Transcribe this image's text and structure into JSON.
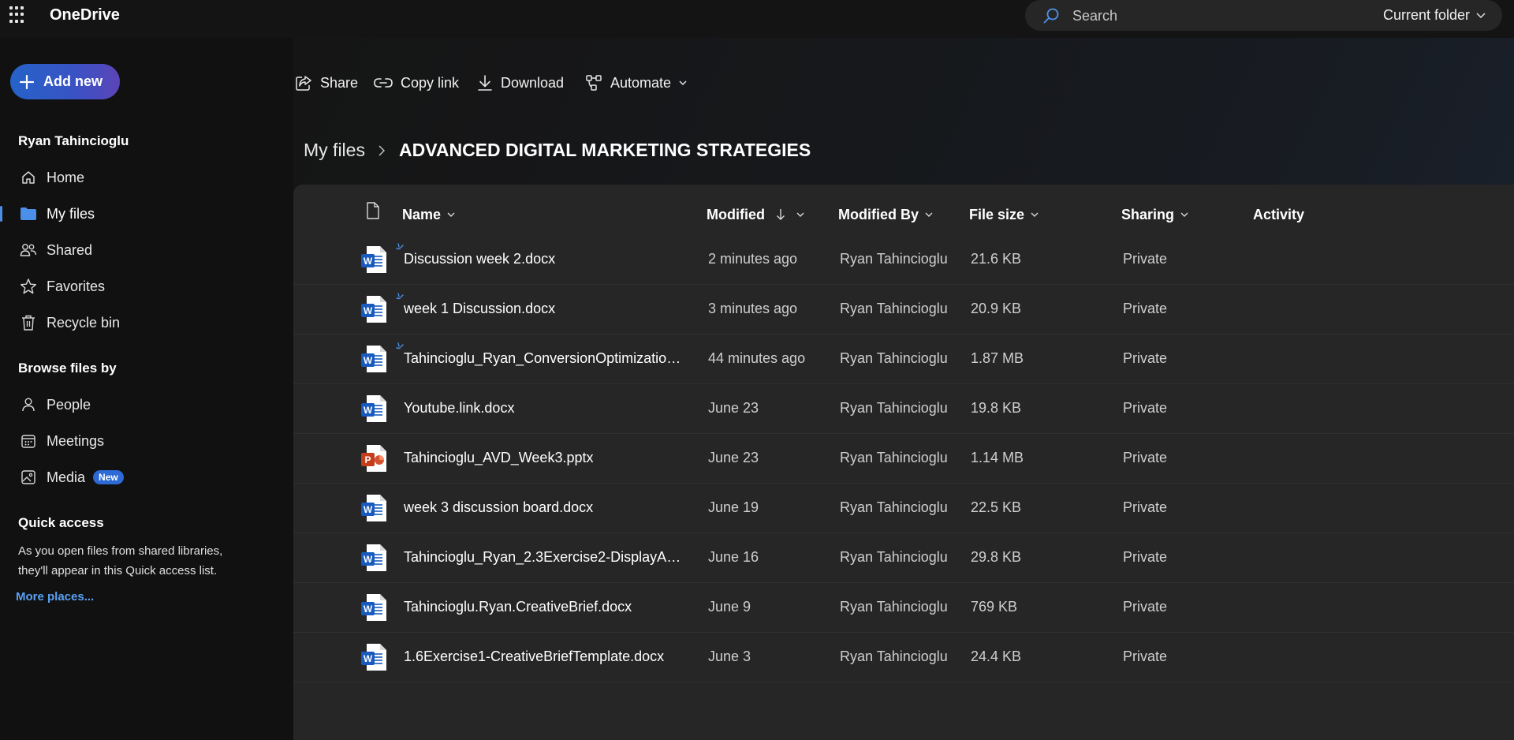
{
  "app": {
    "title": "OneDrive"
  },
  "search": {
    "placeholder": "Search",
    "scope": "Current folder"
  },
  "sidebar": {
    "add_new": "Add new",
    "user_name": "Ryan Tahincioglu",
    "items": [
      {
        "label": "Home",
        "icon": "home-icon"
      },
      {
        "label": "My files",
        "icon": "folder-icon",
        "active": true
      },
      {
        "label": "Shared",
        "icon": "people-icon"
      },
      {
        "label": "Favorites",
        "icon": "star-icon"
      },
      {
        "label": "Recycle bin",
        "icon": "trash-icon"
      }
    ],
    "browse_title": "Browse files by",
    "browse_items": [
      {
        "label": "People",
        "icon": "person-icon"
      },
      {
        "label": "Meetings",
        "icon": "calendar-icon"
      },
      {
        "label": "Media",
        "icon": "image-icon",
        "badge": "New"
      }
    ],
    "quick_access_title": "Quick access",
    "quick_access_text": "As you open files from shared libraries, they'll appear in this Quick access list.",
    "more_places": "More places..."
  },
  "commands": {
    "share": "Share",
    "copy_link": "Copy link",
    "download": "Download",
    "automate": "Automate"
  },
  "breadcrumb": {
    "root": "My files",
    "current": "ADVANCED DIGITAL MARKETING STRATEGIES"
  },
  "columns": {
    "name": "Name",
    "modified": "Modified",
    "modified_by": "Modified By",
    "file_size": "File size",
    "sharing": "Sharing",
    "activity": "Activity"
  },
  "files": [
    {
      "name": "Discussion week 2.docx",
      "modified": "2 minutes ago",
      "modified_by": "Ryan Tahincioglu",
      "size": "21.6 KB",
      "sharing": "Private",
      "type": "word",
      "new": true
    },
    {
      "name": "week 1 Discussion.docx",
      "modified": "3 minutes ago",
      "modified_by": "Ryan Tahincioglu",
      "size": "20.9 KB",
      "sharing": "Private",
      "type": "word",
      "new": true
    },
    {
      "name": "Tahincioglu_Ryan_ConversionOptimization...",
      "modified": "44 minutes ago",
      "modified_by": "Ryan Tahincioglu",
      "size": "1.87 MB",
      "sharing": "Private",
      "type": "word",
      "new": true
    },
    {
      "name": "Youtube.link.docx",
      "modified": "June 23",
      "modified_by": "Ryan Tahincioglu",
      "size": "19.8 KB",
      "sharing": "Private",
      "type": "word",
      "new": false
    },
    {
      "name": "Tahincioglu_AVD_Week3.pptx",
      "modified": "June 23",
      "modified_by": "Ryan Tahincioglu",
      "size": "1.14 MB",
      "sharing": "Private",
      "type": "powerpoint",
      "new": false
    },
    {
      "name": "week 3 discussion board.docx",
      "modified": "June 19",
      "modified_by": "Ryan Tahincioglu",
      "size": "22.5 KB",
      "sharing": "Private",
      "type": "word",
      "new": false
    },
    {
      "name": "Tahincioglu_Ryan_2.3Exercise2-DisplayAd...",
      "modified": "June 16",
      "modified_by": "Ryan Tahincioglu",
      "size": "29.8 KB",
      "sharing": "Private",
      "type": "word",
      "new": false
    },
    {
      "name": "Tahincioglu.Ryan.CreativeBrief.docx",
      "modified": "June 9",
      "modified_by": "Ryan Tahincioglu",
      "size": "769 KB",
      "sharing": "Private",
      "type": "word",
      "new": false
    },
    {
      "name": "1.6Exercise1-CreativeBriefTemplate.docx",
      "modified": "June 3",
      "modified_by": "Ryan Tahincioglu",
      "size": "24.4 KB",
      "sharing": "Private",
      "type": "word",
      "new": false
    }
  ],
  "colors": {
    "accent": "#2563c9",
    "word": "#185abd",
    "powerpoint": "#c43e1c",
    "link": "#5aa0f2"
  }
}
